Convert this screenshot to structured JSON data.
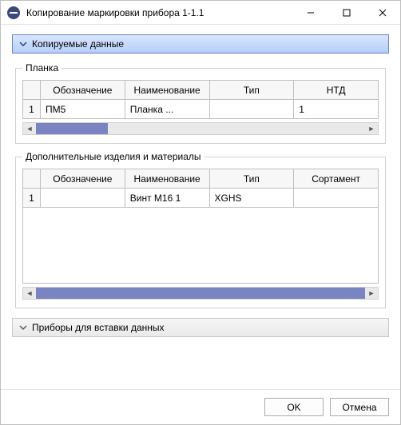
{
  "window": {
    "title": "Копирование маркировки прибора 1-1.1"
  },
  "sections": {
    "copied_data": {
      "header": "Копируемые данные",
      "group_plate": {
        "legend": "Планка",
        "columns": [
          "Обозначение",
          "Наименование",
          "Тип",
          "НТД"
        ],
        "rows": [
          {
            "n": "1",
            "c0": "ПМ5",
            "c1": "Планка ...",
            "c2": "",
            "c3": "1"
          }
        ]
      },
      "group_extra": {
        "legend": "Дополнительные изделия и материалы",
        "columns": [
          "Обозначение",
          "Наименование",
          "Тип",
          "Сортамент"
        ],
        "rows": [
          {
            "n": "1",
            "c0": "",
            "c1": "Винт М16 1",
            "c2": "XGHS",
            "c3": ""
          }
        ]
      }
    },
    "insert_targets": {
      "header": "Приборы для вставки данных"
    }
  },
  "buttons": {
    "ok": "OK",
    "cancel": "Отмена"
  }
}
